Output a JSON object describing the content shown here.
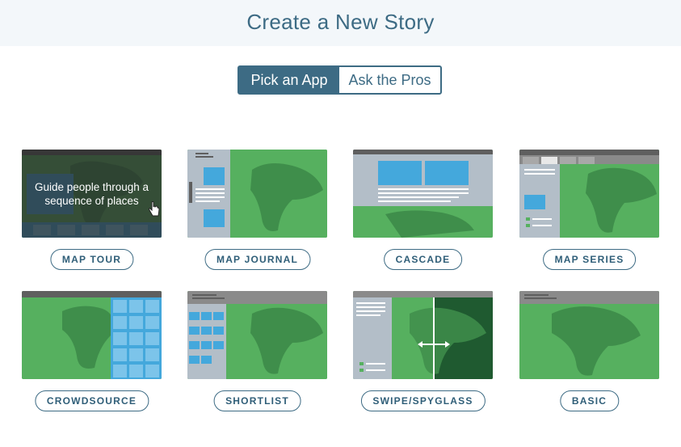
{
  "header": {
    "title": "Create a New Story"
  },
  "toggle": {
    "active_label": "Pick an App",
    "other_label": "Ask the Pros"
  },
  "cards": [
    {
      "label": "MAP TOUR",
      "hover_text": "Guide people through a sequence of places"
    },
    {
      "label": "MAP JOURNAL"
    },
    {
      "label": "CASCADE"
    },
    {
      "label": "MAP SERIES"
    },
    {
      "label": "CROWDSOURCE"
    },
    {
      "label": "SHORTLIST"
    },
    {
      "label": "SWIPE/SPYGLASS"
    },
    {
      "label": "BASIC"
    }
  ],
  "colors": {
    "accent": "#3d6b84",
    "map_land": "#56b05f",
    "map_dark": "#3f8e4b",
    "panel_blue": "#44a8dc",
    "panel_gray": "#b3bec8",
    "bar_dark": "#5f5f5f"
  }
}
